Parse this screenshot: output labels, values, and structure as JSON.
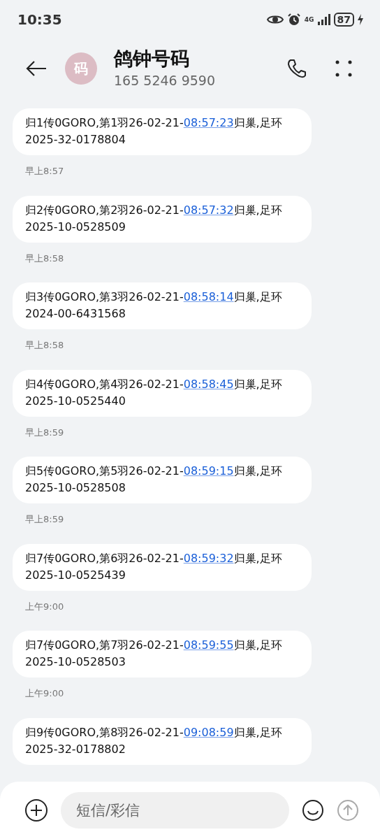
{
  "status_bar": {
    "time": "10:35",
    "network": "4G",
    "battery": "87"
  },
  "header": {
    "avatar": "码",
    "name": "鸽钟号码",
    "number": "165 5246 9590"
  },
  "messages": [
    {
      "before": "归1传0GORO,第1羽26-02-21-",
      "link": "08:57:23",
      "after": "归巢,足环2025-32-0178804",
      "time": "早上8:57"
    },
    {
      "before": "归2传0GORO,第2羽26-02-21-",
      "link": "08:57:32",
      "after": "归巢,足环2025-10-0528509",
      "time": "早上8:58"
    },
    {
      "before": "归3传0GORO,第3羽26-02-21-",
      "link": "08:58:14",
      "after": "归巢,足环2024-00-6431568",
      "time": "早上8:58"
    },
    {
      "before": "归4传0GORO,第4羽26-02-21-",
      "link": "08:58:45",
      "after": "归巢,足环2025-10-0525440",
      "time": "早上8:59"
    },
    {
      "before": "归5传0GORO,第5羽26-02-21-",
      "link": "08:59:15",
      "after": "归巢,足环2025-10-0528508",
      "time": "早上8:59"
    },
    {
      "before": "归7传0GORO,第6羽26-02-21-",
      "link": "08:59:32",
      "after": "归巢,足环2025-10-0525439",
      "time": "上午9:00"
    },
    {
      "before": "归7传0GORO,第7羽26-02-21-",
      "link": "08:59:55",
      "after": "归巢,足环2025-10-0528503",
      "time": "上午9:00"
    },
    {
      "before": "归9传0GORO,第8羽26-02-21-",
      "link": "09:08:59",
      "after": "归巢,足环2025-32-0178802"
    }
  ],
  "composer": {
    "placeholder": "短信/彩信"
  }
}
